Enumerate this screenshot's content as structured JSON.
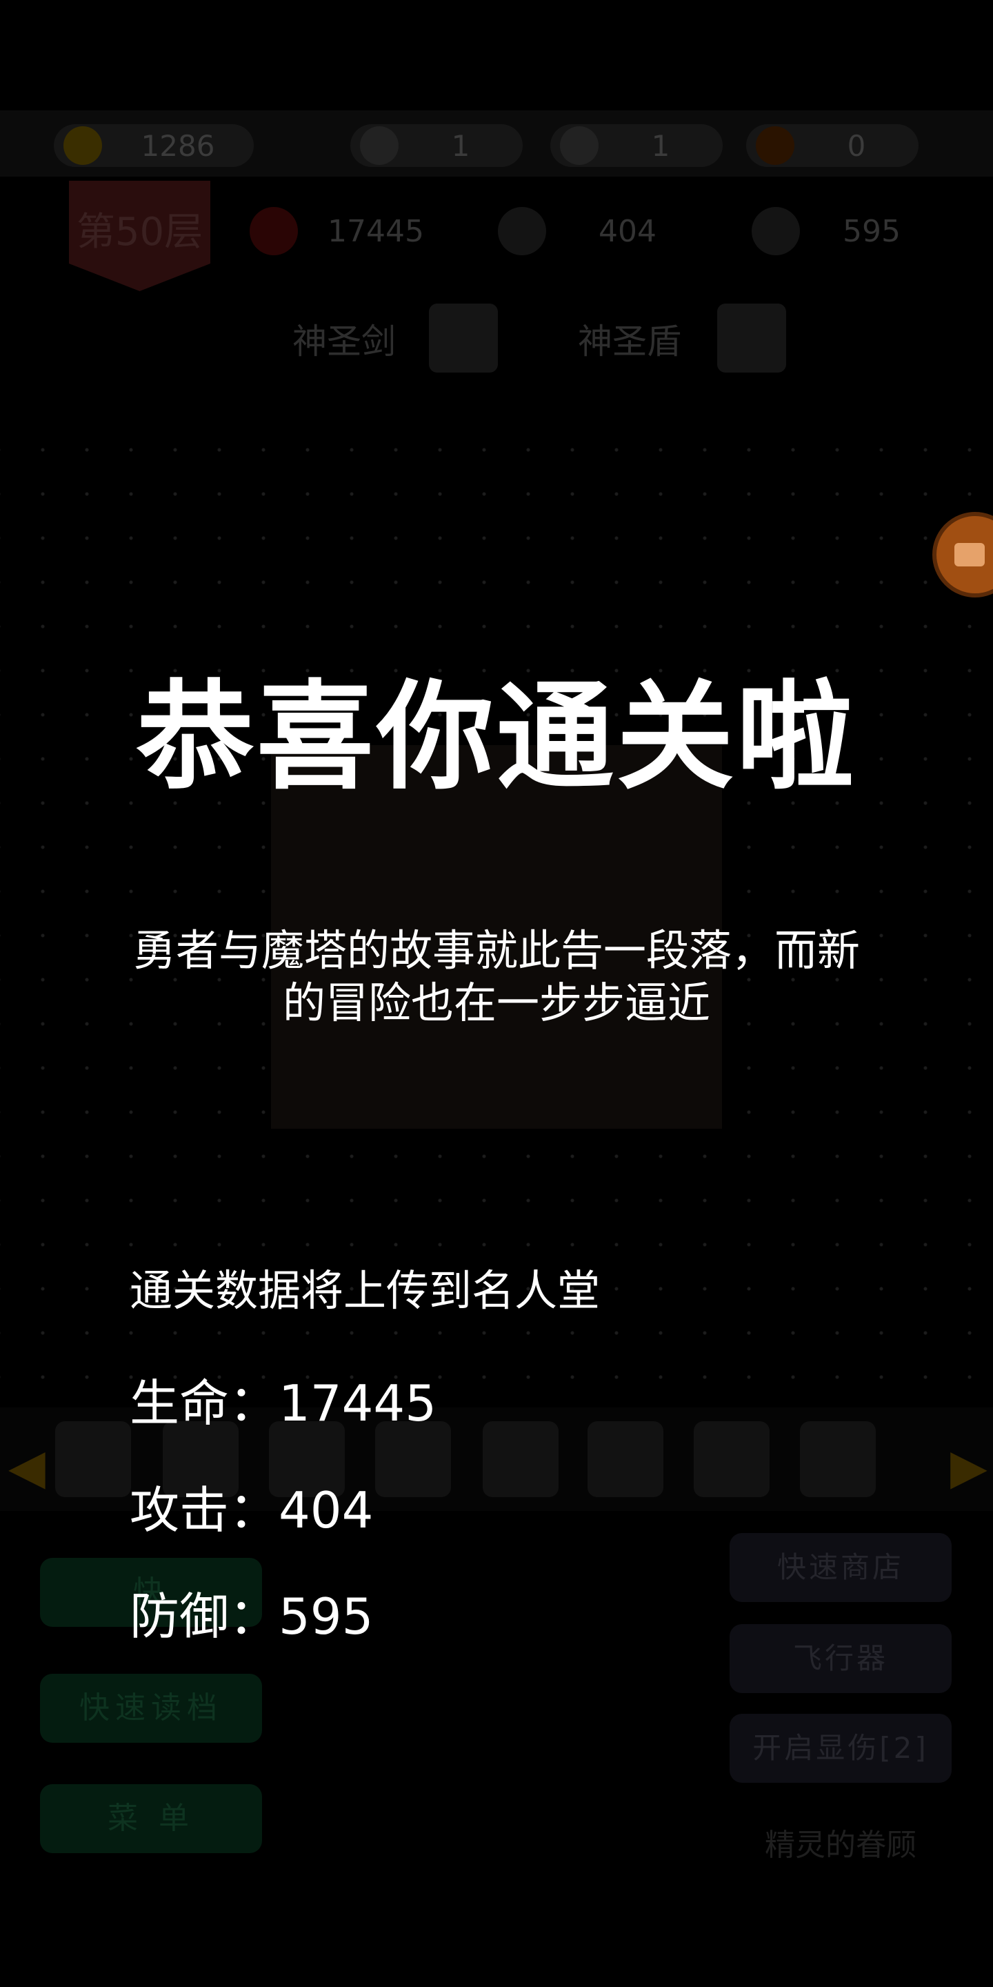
{
  "resources": {
    "gold": "1286",
    "yellow_key": "1",
    "blue_key": "1",
    "red_key": "0"
  },
  "hero": {
    "floor": "第50层",
    "hp": "17445",
    "atk": "404",
    "def": "595",
    "weapon": "神圣剑",
    "shield": "神圣盾"
  },
  "buttons": {
    "quick_save": "快速存档",
    "quick_save_visible": "快",
    "quick_load": "快速读档",
    "menu": "菜 单",
    "quick_shop": "快速商店",
    "fly": "飞行器",
    "show_damage": "开启显伤[2]",
    "fairy": "精灵的眷顾"
  },
  "overlay": {
    "title": "恭喜你通关啦",
    "subtitle": "勇者与魔塔的故事就此告一段落，而新的冒险也在一步步逼近",
    "upload_notice": "通关数据将上传到名人堂",
    "hp_line": "生命：17445",
    "atk_line": "攻击：404",
    "def_line": "防御：595"
  },
  "colors": {
    "accent_orange": "#a14f12",
    "background": "#000000",
    "overlay_text": "#ffffff"
  }
}
